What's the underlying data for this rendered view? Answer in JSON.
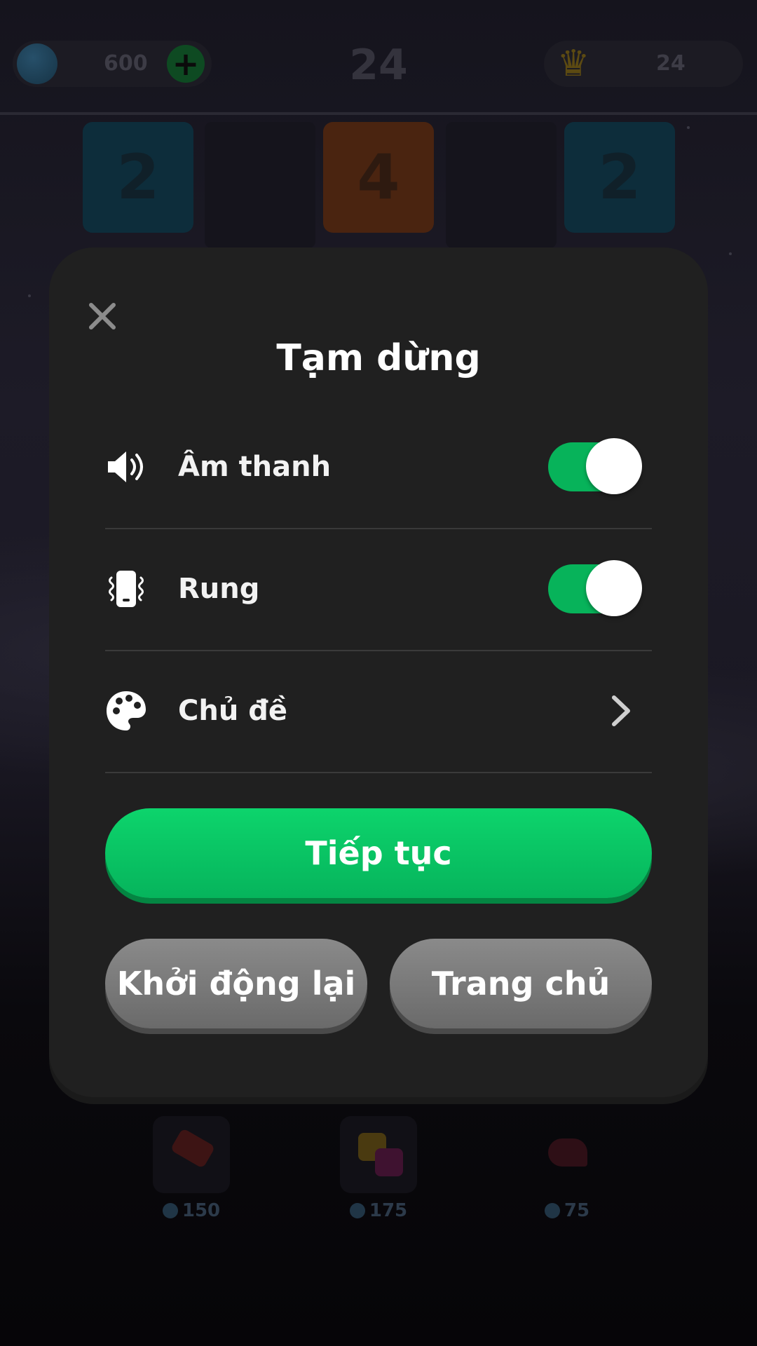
{
  "hud": {
    "gems": "600",
    "level": "24",
    "best": "24"
  },
  "board": {
    "tiles": [
      "2",
      "4",
      "2"
    ]
  },
  "powerups": [
    {
      "name": "hammer",
      "cost": "150"
    },
    {
      "name": "swap",
      "cost": "175"
    },
    {
      "name": "undo",
      "cost": "75"
    }
  ],
  "dialog": {
    "title": "Tạm dừng",
    "sound_label": "Âm thanh",
    "sound_on": true,
    "vibration_label": "Rung",
    "vibration_on": true,
    "theme_label": "Chủ đề",
    "continue_label": "Tiếp tục",
    "restart_label": "Khởi động lại",
    "home_label": "Trang chủ"
  },
  "colors": {
    "accent_green": "#07b35a",
    "dialog_bg": "#202020",
    "secondary_button": "#7a7a7a"
  },
  "icons": {
    "close": "close-icon",
    "sound": "speaker-icon",
    "vibration": "vibrate-icon",
    "theme": "palette-icon",
    "chevron": "chevron-right-icon"
  }
}
